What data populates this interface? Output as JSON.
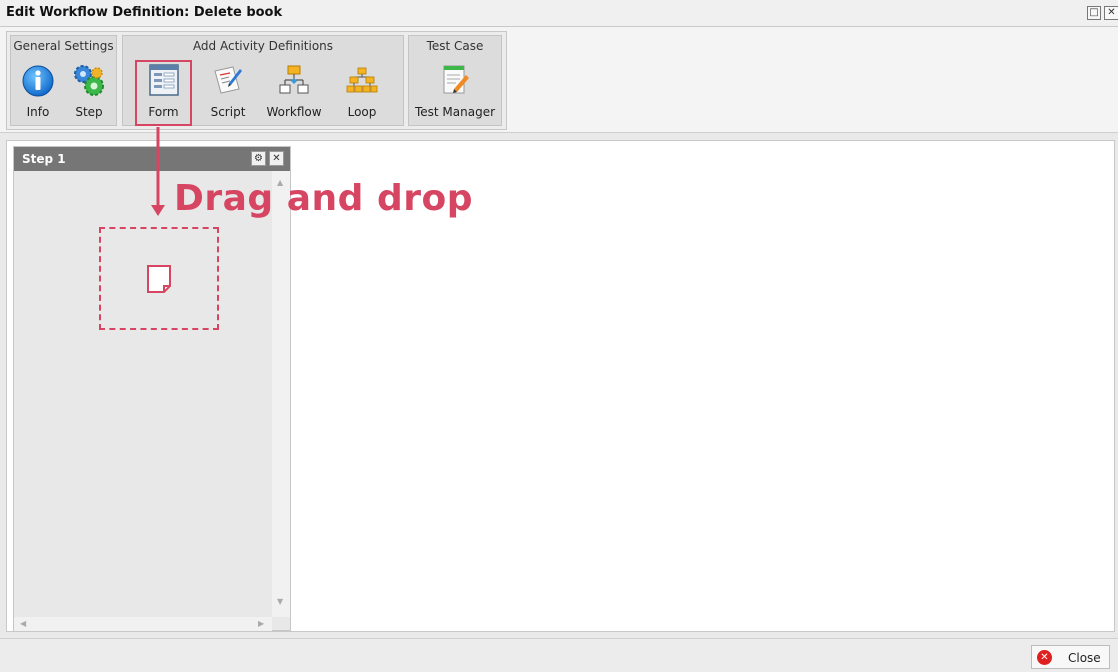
{
  "window": {
    "title": "Edit Workflow Definition: Delete book",
    "restore_glyph": "□",
    "close_glyph": "✕"
  },
  "toolbar": {
    "groups": [
      {
        "label": "General Settings",
        "tools": [
          {
            "label": "Info",
            "icon": "info-icon"
          },
          {
            "label": "Step",
            "icon": "gears-icon"
          }
        ]
      },
      {
        "label": "Add Activity Definitions",
        "tools": [
          {
            "label": "Form",
            "icon": "form-icon",
            "selected": true
          },
          {
            "label": "Script",
            "icon": "script-icon"
          },
          {
            "label": "Workflow",
            "icon": "workflow-icon"
          },
          {
            "label": "Loop",
            "icon": "loop-icon"
          }
        ]
      },
      {
        "label": "Test Case",
        "tools": [
          {
            "label": "Test Manager",
            "icon": "test-manager-icon"
          }
        ]
      }
    ]
  },
  "step_panel": {
    "title": "Step 1",
    "settings_glyph": "⚙",
    "close_glyph": "✕"
  },
  "annotation": {
    "text": "Drag and drop"
  },
  "footer": {
    "close_label": "Close",
    "close_glyph": "✕"
  },
  "colors": {
    "annotation": "#d64562",
    "header": "#767676",
    "close_icon": "#e02020"
  }
}
